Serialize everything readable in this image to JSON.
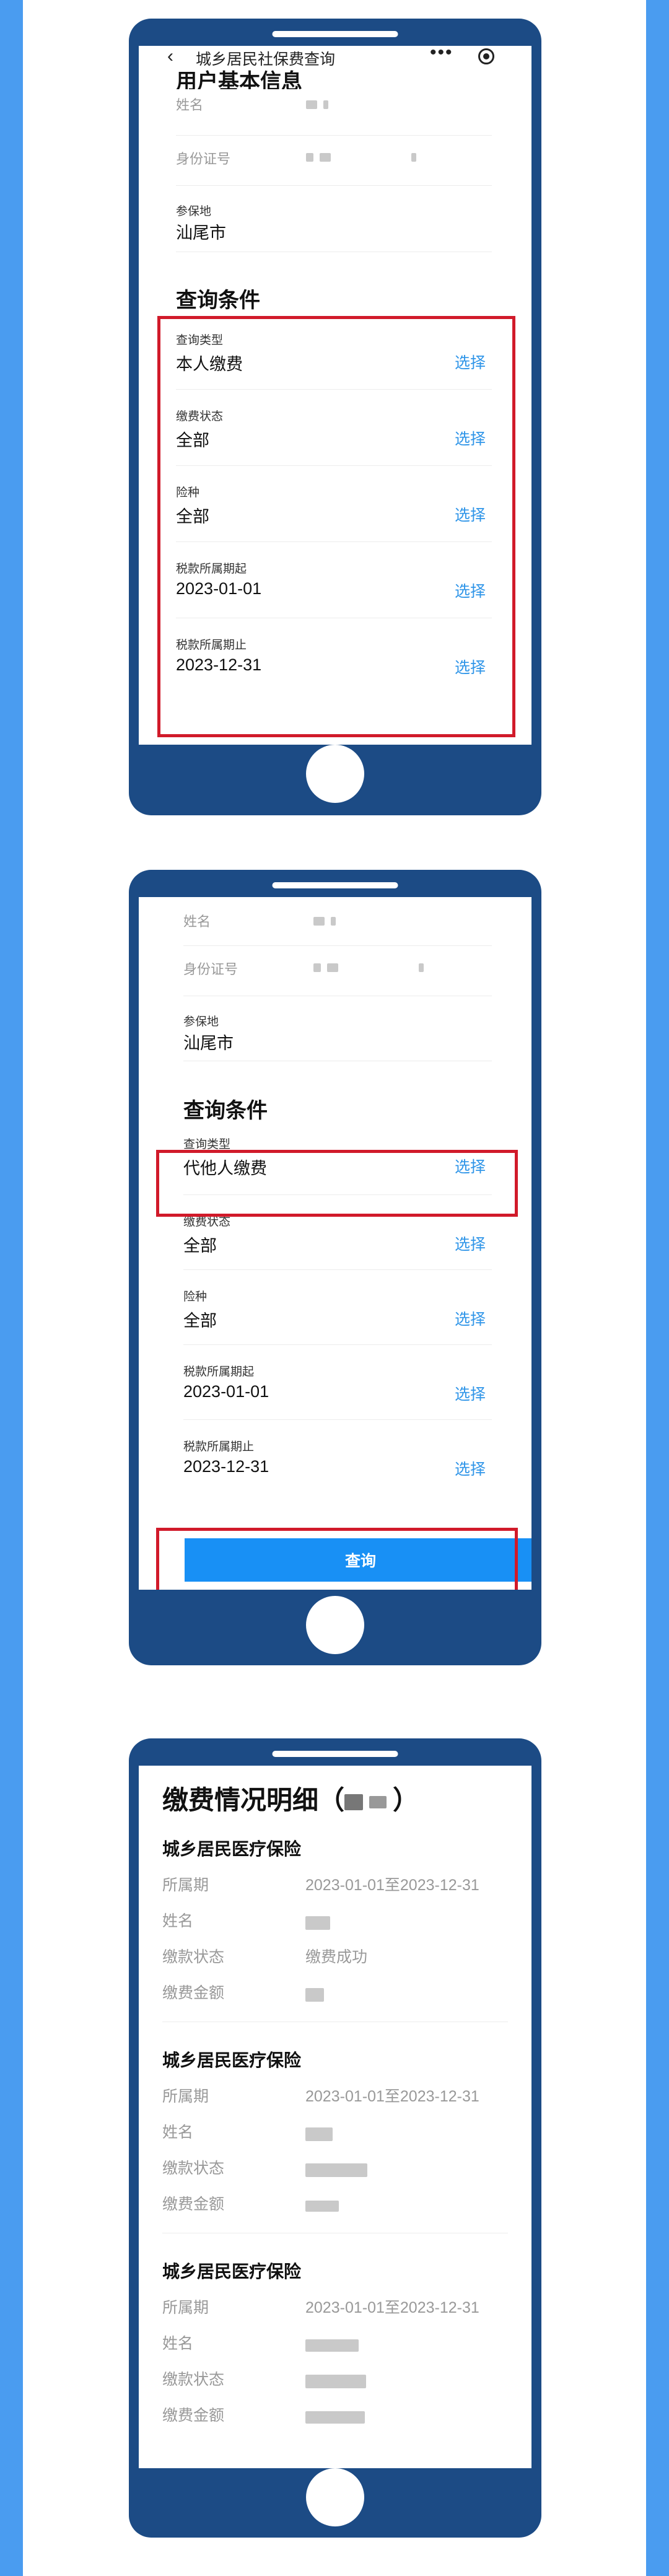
{
  "miniapp_title": "城乡居民社保费查询",
  "nav": {
    "back_icon": "chevron-left-icon",
    "more_icon": "more-dots-icon",
    "close_icon": "target-icon"
  },
  "user_info": {
    "heading": "用户基本信息",
    "name_label": "姓名",
    "id_label": "身份证号",
    "place_label": "参保地",
    "place_value": "汕尾市"
  },
  "conditions": {
    "heading": "查询条件",
    "choose_label": "选择",
    "fields": [
      {
        "label": "查询类型",
        "value": "本人缴费"
      },
      {
        "label": "缴费状态",
        "value": "全部"
      },
      {
        "label": "险种",
        "value": "全部"
      },
      {
        "label": "税款所属期起",
        "value": "2023-01-01"
      },
      {
        "label": "税款所属期止",
        "value": "2023-12-31"
      }
    ],
    "query_type_other": "代他人缴费",
    "query_button": "查询"
  },
  "details": {
    "title": "缴费情况明细（",
    "title_close": "）",
    "period_label": "所属期",
    "name_label": "姓名",
    "status_label": "缴款状态",
    "amount_label": "缴费金额",
    "blocks": [
      {
        "insurance": "城乡居民医疗保险",
        "period": "2023-01-01至2023-12-31",
        "status": "缴费成功"
      },
      {
        "insurance": "城乡居民医疗保险",
        "period": "2023-01-01至2023-12-31",
        "status": ""
      },
      {
        "insurance": "城乡居民医疗保险",
        "period": "2023-01-01至2023-12-31",
        "status": ""
      }
    ]
  },
  "colors": {
    "phone": "#1c4b85",
    "side_bars": "#4a9cf0",
    "link_blue": "#2f95e8",
    "highlight_red": "#d11a2a",
    "button_blue": "#1890f5"
  }
}
